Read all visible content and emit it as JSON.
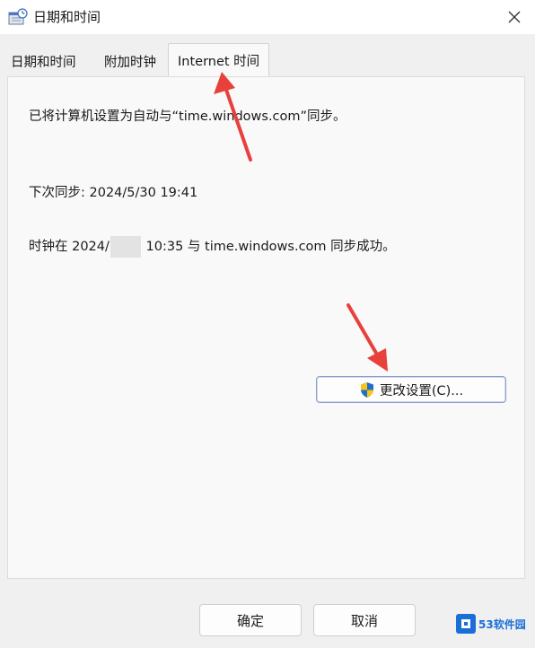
{
  "window": {
    "title": "日期和时间",
    "icons": {
      "app": "date-time-icon",
      "close": "close-icon",
      "shield": "uac-shield-icon"
    }
  },
  "tabs": [
    {
      "label": "日期和时间",
      "active": false
    },
    {
      "label": "附加时钟",
      "active": false
    },
    {
      "label": "Internet 时间",
      "active": true
    }
  ],
  "internet_time": {
    "sync_info": "已将计算机设置为自动与“time.windows.com”同步。",
    "next_sync_label": "下次同步: 2024/5/30 19:41",
    "last_sync_prefix": "时钟在 2024/",
    "last_sync_suffix": "10:35 与 time.windows.com 同步成功。",
    "change_settings_label": "更改设置(C)..."
  },
  "footer": {
    "ok_label": "确定",
    "cancel_label": "取消"
  },
  "watermark": {
    "text": "53软件园"
  },
  "colors": {
    "arrow": "#e8403a",
    "button_border": "#8aa0c8",
    "shield_blue": "#1f6fd0",
    "shield_yellow": "#f5c518"
  }
}
